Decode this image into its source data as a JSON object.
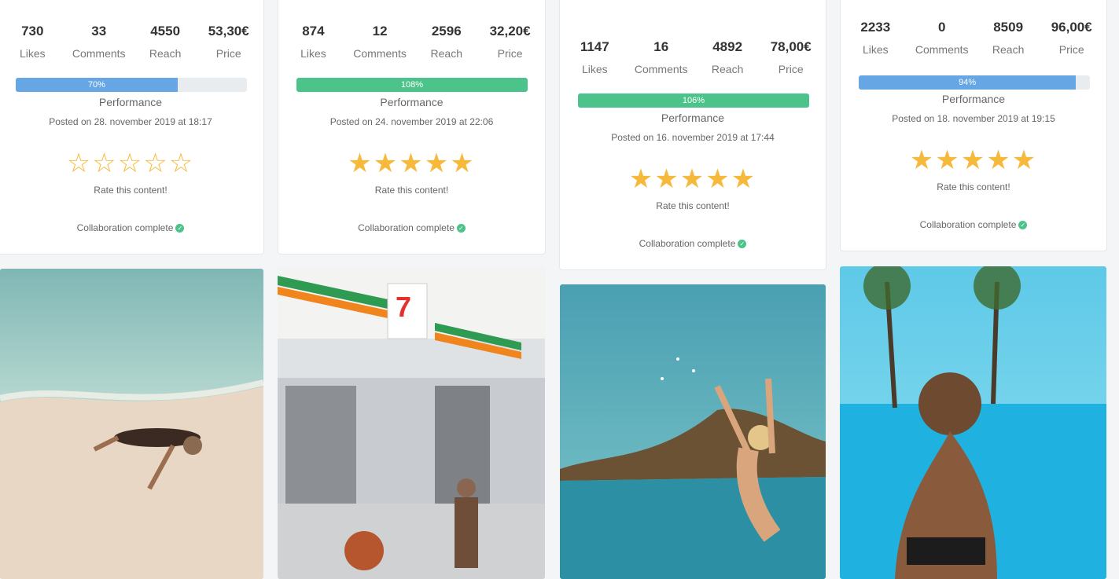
{
  "stat_labels": {
    "likes": "Likes",
    "comments": "Comments",
    "reach": "Reach",
    "price": "Price"
  },
  "common": {
    "performance_label": "Performance",
    "rate_label": "Rate this content!",
    "collab_label": "Collaboration complete"
  },
  "colors": {
    "blue_bar": "#66a6e4",
    "green_bar": "#4cc38a",
    "star": "#f6b93b"
  },
  "cards": [
    {
      "likes": "730",
      "comments": "33",
      "reach": "4550",
      "price": "53,30€",
      "progress_label": "70%",
      "progress": 0.7,
      "bar_color": "blue",
      "posted": "Posted on 28. november 2019 at 18:17",
      "rating": 0
    },
    {
      "likes": "874",
      "comments": "12",
      "reach": "2596",
      "price": "32,20€",
      "progress_label": "108%",
      "progress": 1.0,
      "bar_color": "green",
      "posted": "Posted on 24. november 2019 at 22:06",
      "rating": 5
    },
    {
      "likes": "1147",
      "comments": "16",
      "reach": "4892",
      "price": "78,00€",
      "progress_label": "106%",
      "progress": 1.0,
      "bar_color": "green",
      "posted": "Posted on 16. november 2019 at 17:44",
      "rating": 5
    },
    {
      "likes": "2233",
      "comments": "0",
      "reach": "8509",
      "price": "96,00€",
      "progress_label": "94%",
      "progress": 0.94,
      "bar_color": "blue",
      "posted": "Posted on 18. november 2019 at 19:15",
      "rating": 5
    }
  ],
  "photos": [
    {
      "icon": "beach-photo"
    },
    {
      "icon": "store-photo"
    },
    {
      "icon": "sea-photo"
    },
    {
      "icon": "pool-photo"
    }
  ]
}
